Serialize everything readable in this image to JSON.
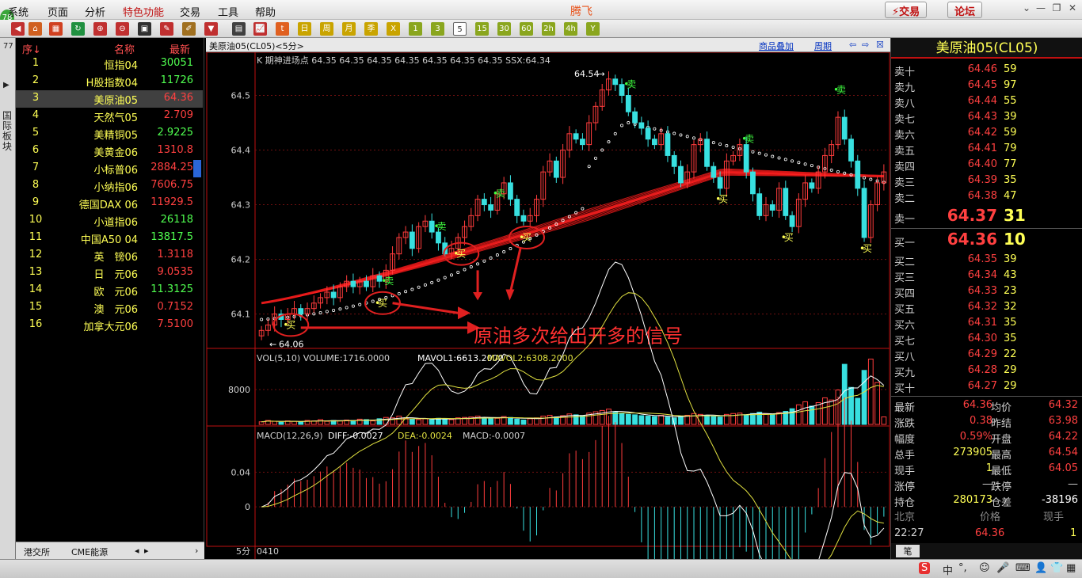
{
  "app": {
    "name": "腾飞",
    "badge": "78"
  },
  "menu": [
    "系统",
    "页面",
    "分析",
    "特色功能",
    "交易",
    "工具",
    "帮助"
  ],
  "header_buttons": {
    "trade": "⚡交易",
    "forum": "论坛"
  },
  "toolbar": {
    "periods": [
      "日",
      "周",
      "月",
      "季",
      "X",
      "1",
      "3",
      "5",
      "15",
      "30",
      "60",
      "2h",
      "4h",
      "Y"
    ],
    "active_period": "5"
  },
  "left_tab": {
    "label": "国际板块",
    "nums": "77"
  },
  "quote_list": {
    "headers": {
      "index": "序↓",
      "name": "名称",
      "price": "最新"
    },
    "rows": [
      {
        "i": "1",
        "name": "恒指04",
        "price": "30051",
        "color": "#50ff50"
      },
      {
        "i": "2",
        "name": "H股指数04",
        "price": "11726",
        "color": "#50ff50"
      },
      {
        "i": "3",
        "name": "美原油05",
        "price": "64.36",
        "color": "#ff4040"
      },
      {
        "i": "4",
        "name": "天然气05",
        "price": "2.709",
        "color": "#ff4040"
      },
      {
        "i": "5",
        "name": "美精铜05",
        "price": "2.9225",
        "color": "#50ff50"
      },
      {
        "i": "6",
        "name": "美黄金06",
        "price": "1310.8",
        "color": "#ff4040"
      },
      {
        "i": "7",
        "name": "小标普06",
        "price": "2884.25",
        "color": "#ff4040"
      },
      {
        "i": "8",
        "name": "小纳指06",
        "price": "7606.75",
        "color": "#ff4040"
      },
      {
        "i": "9",
        "name": "德国DAX 06",
        "price": "11929.5",
        "color": "#ff4040"
      },
      {
        "i": "10",
        "name": "小道指06",
        "price": "26118",
        "color": "#50ff50"
      },
      {
        "i": "11",
        "name": "中国A50 04",
        "price": "13817.5",
        "color": "#50ff50"
      },
      {
        "i": "12",
        "name": "英　镑06",
        "price": "1.3118",
        "color": "#ff4040"
      },
      {
        "i": "13",
        "name": "日　元06",
        "price": "9.0535",
        "color": "#ff4040"
      },
      {
        "i": "14",
        "name": "欧　元06",
        "price": "11.3125",
        "color": "#50ff50"
      },
      {
        "i": "15",
        "name": "澳　元06",
        "price": "0.7152",
        "color": "#ff4040"
      },
      {
        "i": "16",
        "name": "加拿大元06",
        "price": "7.5100",
        "color": "#ff4040"
      }
    ],
    "tabs": [
      "港交所",
      "CME能源"
    ]
  },
  "chart_header": {
    "title": "美原油05(CL05)<5分>",
    "overlay": "商品叠加",
    "period": "周期"
  },
  "chart_data": {
    "type": "candlestick",
    "main_legend": "K  期神进场点  64.35 64.35 64.35 64.35 64.35 64.35 64.35  SSX:64.34",
    "price_axis": [
      "64.5",
      "64.4",
      "64.3",
      "64.2",
      "64.1"
    ],
    "ylim": [
      64.04,
      64.55
    ],
    "high_label": "64.54",
    "low_label": "64.06",
    "annotation": "原油多次给出开多的信号",
    "signals": {
      "buy": "买",
      "sell": "卖",
      "buy_points": [
        [
          4,
          64.08
        ],
        [
          18,
          64.12
        ],
        [
          30,
          64.21
        ],
        [
          40,
          64.24
        ],
        [
          70,
          64.31
        ],
        [
          80,
          64.24
        ],
        [
          92,
          64.22
        ]
      ],
      "sell_points": [
        [
          19,
          64.16
        ],
        [
          27,
          64.26
        ],
        [
          36,
          64.32
        ],
        [
          56,
          64.52
        ],
        [
          74,
          64.42
        ],
        [
          88,
          64.51
        ]
      ]
    },
    "candles": [
      64.07,
      64.08,
      64.1,
      64.09,
      64.1,
      64.11,
      64.1,
      64.11,
      64.12,
      64.13,
      64.14,
      64.13,
      64.15,
      64.16,
      64.15,
      64.16,
      64.15,
      64.17,
      64.16,
      64.18,
      64.21,
      64.24,
      64.25,
      64.22,
      64.26,
      64.27,
      64.25,
      64.23,
      64.21,
      64.22,
      64.24,
      64.26,
      64.28,
      64.31,
      64.3,
      64.29,
      64.32,
      64.34,
      64.31,
      64.28,
      64.27,
      64.28,
      64.31,
      64.36,
      64.38,
      64.35,
      64.4,
      64.43,
      64.42,
      64.41,
      64.45,
      64.48,
      64.51,
      64.53,
      64.52,
      64.5,
      64.47,
      64.45,
      64.44,
      64.42,
      64.41,
      64.43,
      64.39,
      64.37,
      64.34,
      64.36,
      64.41,
      64.42,
      64.37,
      64.35,
      64.33,
      64.38,
      64.39,
      64.41,
      64.36,
      64.32,
      64.28,
      64.3,
      64.29,
      64.33,
      64.28,
      64.26,
      64.31,
      64.34,
      64.33,
      64.36,
      64.39,
      64.41,
      64.46,
      64.42,
      64.38,
      64.33,
      64.24,
      64.3,
      64.34,
      64.36
    ],
    "vol_legend": {
      "label": "VOL(5,10) VOLUME:1716.0000",
      "mavol1": "MAVOL1:6613.2000",
      "mavol2": "MAVOL2:6308.2000"
    },
    "vol_axis": "8000",
    "volumes": [
      600,
      900,
      700,
      500,
      800,
      700,
      600,
      900,
      800,
      1100,
      700,
      900,
      800,
      1000,
      900,
      1200,
      1100,
      800,
      1300,
      1600,
      1500,
      1900,
      1400,
      1200,
      1100,
      1300,
      1200,
      1400,
      1300,
      1100,
      1500,
      1600,
      1700,
      1900,
      1500,
      1300,
      1400,
      1800,
      1600,
      1200,
      1000,
      1300,
      1500,
      1900,
      2100,
      1700,
      2000,
      2400,
      2200,
      2000,
      2600,
      2900,
      3200,
      3500,
      2800,
      2500,
      2300,
      2200,
      2000,
      1900,
      1800,
      2100,
      1700,
      1500,
      1900,
      2100,
      2500,
      2300,
      2000,
      1800,
      1700,
      2300,
      2500,
      2600,
      2200,
      2500,
      2800,
      2400,
      2300,
      2700,
      3000,
      3600,
      4500,
      5200,
      4200,
      5000,
      6100,
      5600,
      7900,
      13800,
      8500,
      6000,
      12400,
      15000,
      9600,
      1716
    ],
    "macd_legend": {
      "label": "MACD(12,26,9)",
      "diff": "DIFF:-0.0027",
      "dea": "DEA:-0.0024",
      "macd": "MACD:-0.0007"
    },
    "macd_axis": [
      "0.04",
      "0"
    ],
    "time_labels": {
      "period": "5分",
      "date": "0410"
    }
  },
  "right_panel": {
    "title": "美原油05(CL05)",
    "asks": [
      {
        "l": "卖十",
        "p": "64.46",
        "v": "59"
      },
      {
        "l": "卖九",
        "p": "64.45",
        "v": "97"
      },
      {
        "l": "卖八",
        "p": "64.44",
        "v": "55"
      },
      {
        "l": "卖七",
        "p": "64.43",
        "v": "39"
      },
      {
        "l": "卖六",
        "p": "64.42",
        "v": "59"
      },
      {
        "l": "卖五",
        "p": "64.41",
        "v": "79"
      },
      {
        "l": "卖四",
        "p": "64.40",
        "v": "77"
      },
      {
        "l": "卖三",
        "p": "64.39",
        "v": "35"
      },
      {
        "l": "卖二",
        "p": "64.38",
        "v": "47"
      }
    ],
    "ask1": {
      "l": "卖一",
      "p": "64.37",
      "v": "31"
    },
    "bid1": {
      "l": "买一",
      "p": "64.36",
      "v": "10"
    },
    "bids": [
      {
        "l": "买二",
        "p": "64.35",
        "v": "39"
      },
      {
        "l": "买三",
        "p": "64.34",
        "v": "43"
      },
      {
        "l": "买四",
        "p": "64.33",
        "v": "23"
      },
      {
        "l": "买五",
        "p": "64.32",
        "v": "32"
      },
      {
        "l": "买六",
        "p": "64.31",
        "v": "35"
      },
      {
        "l": "买七",
        "p": "64.30",
        "v": "35"
      },
      {
        "l": "买八",
        "p": "64.29",
        "v": "22"
      },
      {
        "l": "买九",
        "p": "64.28",
        "v": "29"
      },
      {
        "l": "买十",
        "p": "64.27",
        "v": "29"
      }
    ],
    "stats": [
      {
        "k1": "最新",
        "v1": "64.36",
        "k2": "均价",
        "v2": "64.32"
      },
      {
        "k1": "涨跌",
        "v1": "0.38",
        "k2": "昨结",
        "v2": "63.98"
      },
      {
        "k1": "幅度",
        "v1": "0.59%",
        "k2": "开盘",
        "v2": "64.22"
      },
      {
        "k1": "总手",
        "v1": "273905",
        "k2": "最高",
        "v2": "64.54"
      },
      {
        "k1": "现手",
        "v1": "1",
        "k2": "最低",
        "v2": "64.05"
      },
      {
        "k1": "涨停",
        "v1": "—",
        "k2": "跌停",
        "v2": "—"
      },
      {
        "k1": "持仓",
        "v1": "280173",
        "k2": "仓差",
        "v2": "-38196"
      }
    ],
    "ticks": {
      "h1": "北京",
      "h2": "价格",
      "h3": "现手",
      "time": "22:27",
      "price": "64.36",
      "vol": "1"
    },
    "bottom_tab": "笔"
  },
  "colors": {
    "up": "#ff3c3c",
    "down": "#38e0e0",
    "ma": "#e01818",
    "dots": "#ffffff",
    "yellow": "#ffff55",
    "buy": "#ffff55",
    "sell": "#40ff40"
  }
}
